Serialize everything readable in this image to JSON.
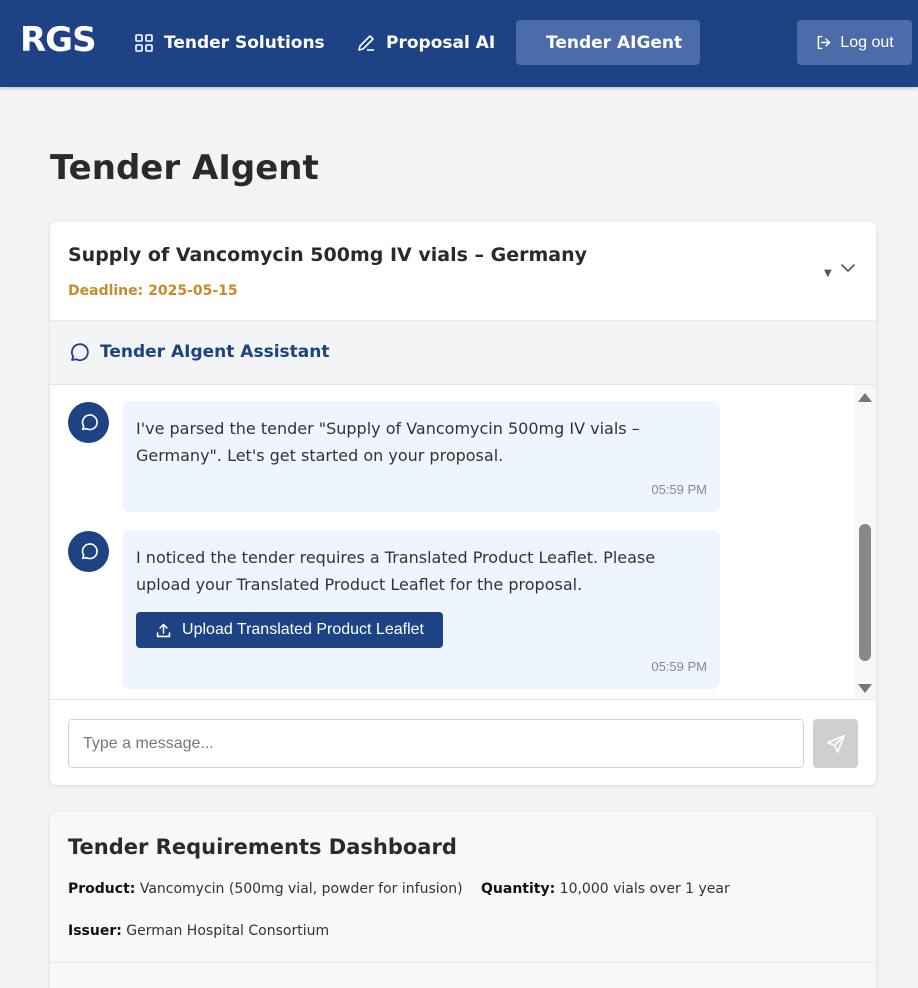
{
  "nav": {
    "logo": "RGS",
    "items": [
      {
        "label": "Tender Solutions",
        "icon": "grid-icon"
      },
      {
        "label": "Proposal AI",
        "icon": "pencil-icon"
      },
      {
        "label": "Tender AIGent",
        "icon": "flow-icon",
        "active": true
      }
    ],
    "logout_label": "Log out"
  },
  "page": {
    "title": "Tender AIgent"
  },
  "tender": {
    "title": "Supply of Vancomycin 500mg IV vials – Germany",
    "deadline": "Deadline: 2025-05-15"
  },
  "assistant": {
    "title": "Tender AIgent Assistant",
    "messages": [
      {
        "text": "I've parsed the tender \"Supply of Vancomycin 500mg IV vials – Germany\". Let's get started on your proposal.",
        "time": "05:59 PM"
      },
      {
        "text": "I noticed the tender requires a Translated Product Leaflet. Please upload your Translated Product Leaflet for the proposal.",
        "button_label": "Upload Translated Product Leaflet",
        "time": "05:59 PM"
      }
    ],
    "input_placeholder": "Type a message..."
  },
  "requirements": {
    "title": "Tender Requirements Dashboard",
    "product_label": "Product:",
    "product_value": "Vancomycin (500mg vial, powder for infusion)",
    "quantity_label": "Quantity:",
    "quantity_value": "10,000 vials over 1 year",
    "issuer_label": "Issuer:",
    "issuer_value": "German Hospital Consortium"
  },
  "colors": {
    "brand": "#1d4385",
    "nav_active": "#4b6ca9",
    "deadline": "#c98a2c",
    "bubble": "#eef5fe"
  }
}
